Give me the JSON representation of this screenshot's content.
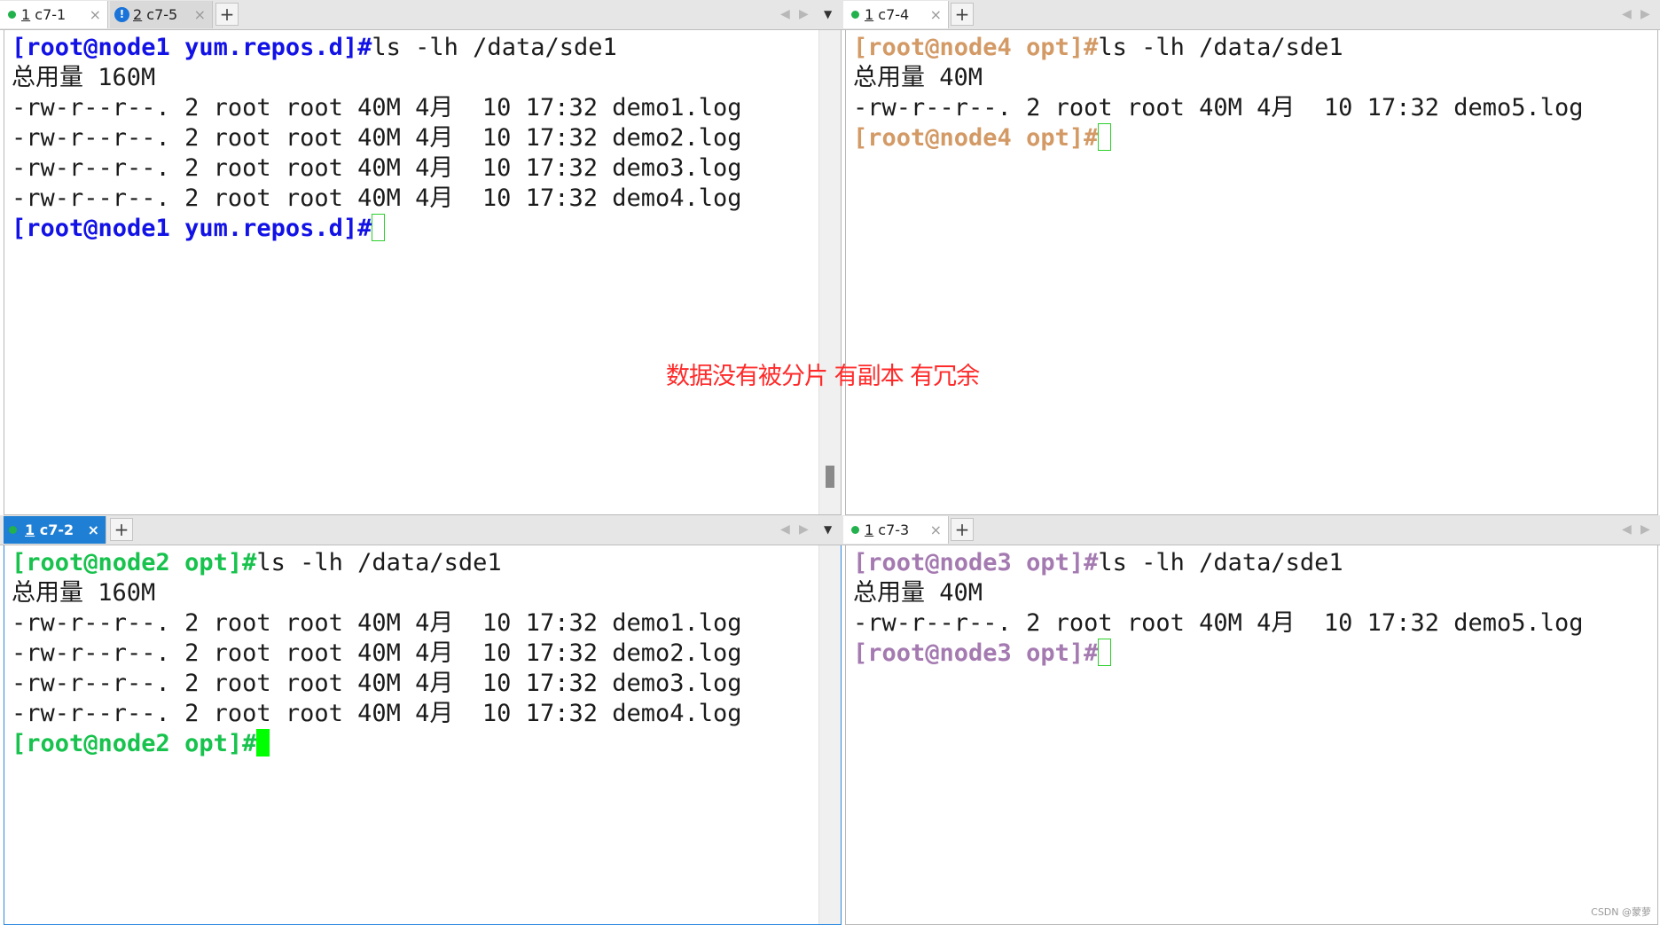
{
  "panes": {
    "top_left": {
      "tabs": [
        {
          "num": "1",
          "name": "c7-1"
        },
        {
          "num": "2",
          "name": "c7-5"
        }
      ],
      "add_tab": "+",
      "close_glyph": "×",
      "lines": [
        {
          "prompt": "[root@node1 yum.repos.d]#",
          "command": "ls -lh /data/sde1"
        },
        {
          "text": "总用量 160M"
        },
        {
          "text": "-rw-r--r--. 2 root root 40M 4月  10 17:32 demo1.log"
        },
        {
          "text": "-rw-r--r--. 2 root root 40M 4月  10 17:32 demo2.log"
        },
        {
          "text": "-rw-r--r--. 2 root root 40M 4月  10 17:32 demo3.log"
        },
        {
          "text": "-rw-r--r--. 2 root root 40M 4月  10 17:32 demo4.log"
        },
        {
          "prompt": "[root@node1 yum.repos.d]#"
        }
      ]
    },
    "top_right": {
      "tabs": [
        {
          "num": "1",
          "name": "c7-4"
        }
      ],
      "add_tab": "+",
      "close_glyph": "×",
      "lines": [
        {
          "prompt": "[root@node4 opt]#",
          "command": "ls -lh /data/sde1"
        },
        {
          "text": "总用量 40M"
        },
        {
          "text": "-rw-r--r--. 2 root root 40M 4月  10 17:32 demo5.log"
        },
        {
          "prompt": "[root@node4 opt]#"
        }
      ]
    },
    "bottom_left": {
      "tabs": [
        {
          "num": "1",
          "name": "c7-2"
        }
      ],
      "add_tab": "+",
      "close_glyph": "×",
      "lines": [
        {
          "prompt": "[root@node2 opt]#",
          "command": "ls -lh /data/sde1"
        },
        {
          "text": "总用量 160M"
        },
        {
          "text": "-rw-r--r--. 2 root root 40M 4月  10 17:32 demo1.log"
        },
        {
          "text": "-rw-r--r--. 2 root root 40M 4月  10 17:32 demo2.log"
        },
        {
          "text": "-rw-r--r--. 2 root root 40M 4月  10 17:32 demo3.log"
        },
        {
          "text": "-rw-r--r--. 2 root root 40M 4月  10 17:32 demo4.log"
        },
        {
          "prompt": "[root@node2 opt]#"
        }
      ]
    },
    "bottom_right": {
      "tabs": [
        {
          "num": "1",
          "name": "c7-3"
        }
      ],
      "add_tab": "+",
      "close_glyph": "×",
      "lines": [
        {
          "prompt": "[root@node3 opt]#",
          "command": "ls -lh /data/sde1"
        },
        {
          "text": "总用量 40M"
        },
        {
          "text": "-rw-r--r--. 2 root root 40M 4月  10 17:32 demo5.log"
        },
        {
          "prompt": "[root@node3 opt]#"
        }
      ]
    }
  },
  "annotation": "数据没有被分片 有副本 有冗余",
  "watermark": "CSDN @蒙萝",
  "colors": {
    "node1_prompt": "#1212e6",
    "node2_prompt": "#17c24d",
    "node3_prompt": "#a47ab1",
    "node4_prompt": "#d39a66",
    "annotation": "#ff2a2a",
    "active_tab": "#1f7fd4",
    "status_dot": "#22b14c"
  },
  "icons": {
    "tab_status": "green-dot-icon",
    "tab_alert": "info-icon",
    "nav_left": "chevron-left-icon",
    "nav_right": "chevron-right-icon",
    "menu": "dropdown-icon"
  }
}
